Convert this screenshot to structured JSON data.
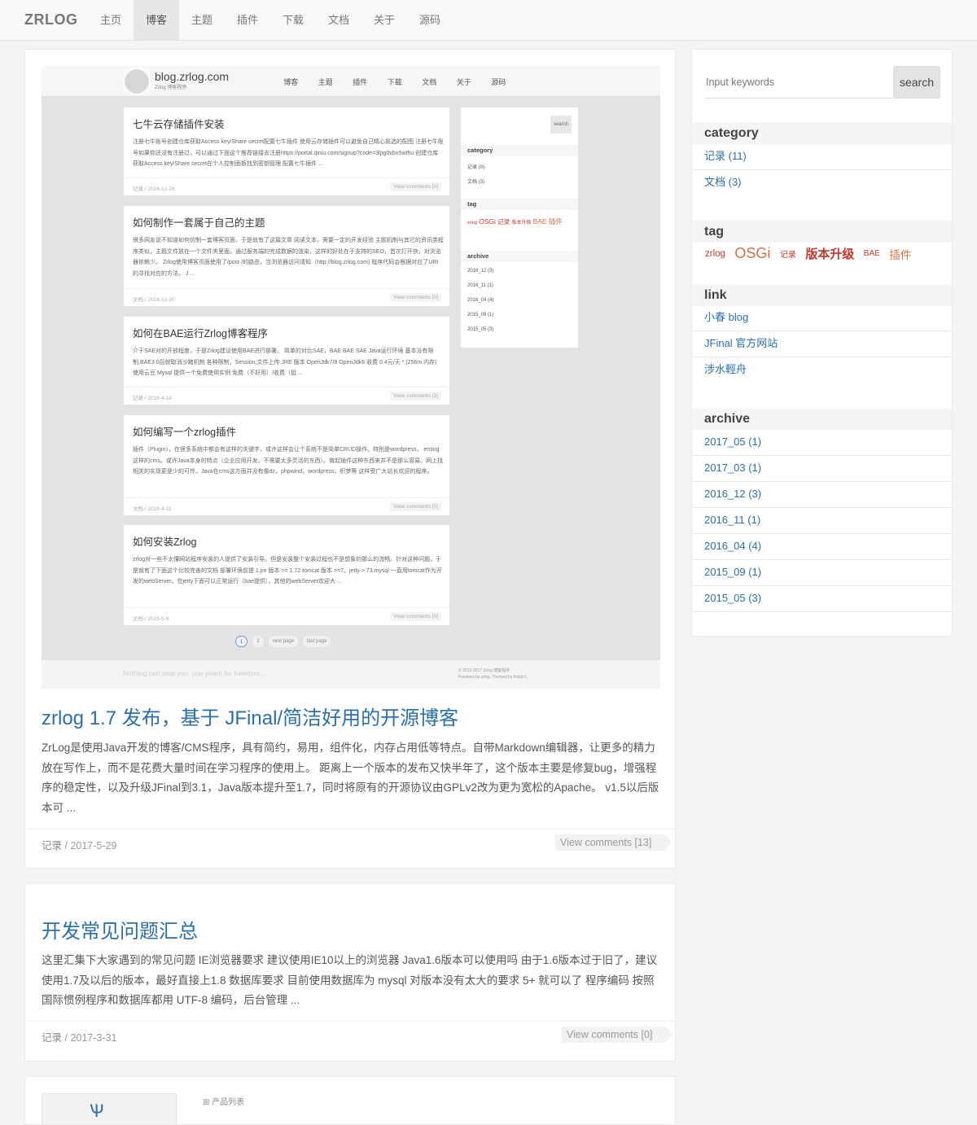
{
  "nav": {
    "brand": "ZRLOG",
    "items": [
      "主页",
      "博客",
      "主题",
      "插件",
      "下载",
      "文档",
      "关于",
      "源码"
    ],
    "active_index": 1
  },
  "posts": [
    {
      "title": "zrlog 1.7 发布，基于 JFinal/简洁好用的开源博客",
      "excerpt": "ZrLog是使用Java开发的博客/CMS程序，具有简约，易用，组件化，内存占用低等特点。自带Markdown编辑器，让更多的精力放在写作上，而不是花费大量时间在学习程序的使用上。 距离上一个版本的发布又快半年了，这个版本主要是修复bug，增强程序的稳定性，以及升级JFinal到3.1，Java版本提升至1.7，同时将原有的开源协议由GPLv2改为更为宽松的Apache。 v1.5以后版本可 ...",
      "category": "记录",
      "date": "2017-5-29",
      "comments": "View comments [13]"
    },
    {
      "title": "开发常见问题汇总",
      "excerpt": "这里汇集下大家遇到的常见问题 IE浏览器要求 建议使用IE10以上的浏览器 Java1.6版本可以使用吗 由于1.6版本过于旧了，建议使用1.7及以后的版本，最好直接上1.8 数据库要求 目前使用数据库为 mysql 对版本没有太大的要求 5+ 就可以了 程序编码 按照国际惯例程序和数据库都用 UTF-8 编码，后台管理 ...",
      "category": "记录",
      "date": "2017-3-31",
      "comments": "View comments [0]"
    }
  ],
  "post3": {
    "product_label": "产品列表",
    "logo_glyph": "Ѱ"
  },
  "screenshot": {
    "domain": "blog.zrlog.com",
    "subtitle": "Zrlog 博客程序",
    "nav": [
      "博客",
      "主题",
      "插件",
      "下载",
      "文档",
      "关于",
      "源码"
    ],
    "cards": [
      {
        "title": "七牛云存储插件安装",
        "excerpt": "注册七牛账号创建仓库获取Access key/Share secret配置七牛插件 使用云存储插件可以避免自己精心挑选的配图 注册七牛账号如果你还没有注册过，可以通过下面这个推荐链接去注册https://portal.qiniu.com/signup?code=3lpg0vbo5wthu 创建仓库 获取Access key/Share secret在个人控制面板找到密钥管理 配置七牛插件 ...",
        "meta": "记录 / 2016-12-26",
        "comments": "View comments [0]"
      },
      {
        "title": "如何制作一套属于自己的主题",
        "excerpt": "很多网友说不知道如何仿制一套博客页面，于是就有了这篇文章 阅读文本，需要一定的开发经验 主题机制与其它的资讯类程序类似，主题文件放在一个文件夹里面，通过服务端的完成数据的渲染，这样的好处在于支持的SEO，首次打开快，对浏览器依赖少。 Zrlog使用博客页面使用了/post /的路由，当浏览器访问请知（http://blog.zrlog.com) 程序代码会根据对应了URI的寻找对应的方法。 J ...",
        "meta": "文档 / 2016-12-20",
        "comments": "View comments [0]"
      },
      {
        "title": "如何在BAE运行Zrlog博客程序",
        "excerpt": "介于SAE对的开放程度，于是Zrlog建议使用BAE进行部署。 简单的对比SAE，BAE BAE SAE Java运行环境 基本没有限制,BAE3.0后就取消沙箱机制 各种限制，Session,文件上传 JRE 版本 OpenJdk7/8 OpenJdk6 收费 0.4元/天 * (256m 内存) 使用云豆 Mysql 提供一个免费使用实例 免费（不好用）/收费（挺 ...",
        "meta": "记录 / 2016-4-14",
        "comments": "View comments [3]"
      },
      {
        "title": "如何编写一个zrlog插件",
        "excerpt": "插件（Plugin），在很多系统中都会有这样的关键字，或许这样会让个系统不是简单CRUD操作。特别是wordpress， emlog 这样的cms。或许Java本身的特点（企业应用开发，不需要太多灵活的东西）。做起插件这种东西来并不是那么容易。网上找相关的实现更是少的可怜。Java在cms这方面并没有像dz，phpwind，wordpress，织梦等 这样受广大站长欢迎的程序。",
        "meta": "文档 / 2016-4-11",
        "comments": "View comments [0]"
      },
      {
        "title": "如何安装Zrlog",
        "excerpt": "zrlog对一些不太懂网站程序安装的人提供了安装引导。但是安装整个安装过程也不是想象的那么的流畅。针对这种问题，于是就有了下面这个比较完善的文档 部署环境前提 1.jre 版本 >= 1.72.tomcat 版本 >=7。jetty > 73.mysql 一直用tomcat作为开发的webServer。在jetty下面可以正常运行（bae提供），其他的webServer欢迎大 ...",
        "meta": "文档 / 2015-5-9",
        "comments": "View comments [0]"
      }
    ],
    "sidebar": {
      "search": "search",
      "category_title": "category",
      "categories": [
        "记录 (9)",
        "文档 (3)"
      ],
      "tag_title": "tag",
      "tags": [
        "zrlog",
        "OSGi",
        "记录",
        "版本升级",
        "BAE",
        "插件"
      ],
      "archive_title": "archive",
      "archives": [
        "2016_12 (3)",
        "2016_11 (1)",
        "2016_04 (4)",
        "2015_09 (1)",
        "2015_05 (3)"
      ]
    },
    "pager": [
      "1",
      "2",
      "next page",
      "last page"
    ],
    "footer_left": "Nothing can stop you, you yearn for freedom...",
    "footer_right_1": "© 2013-2017 Zrlog 博客程序",
    "footer_right_2": "Powered by zrlog. Themed by Robin L."
  },
  "sidebar": {
    "search_placeholder": "Input keywords",
    "search_label": "search",
    "category_title": "category",
    "categories": [
      "记录 (11)",
      "文档 (3)"
    ],
    "tag_title": "tag",
    "tags": [
      "zrlog",
      "OSGi",
      "记录",
      "版本升级",
      "BAE",
      "插件"
    ],
    "link_title": "link",
    "links": [
      "小春 blog",
      "JFinal 官方网站",
      "涉水輕舟"
    ],
    "archive_title": "archive",
    "archives": [
      "2017_05 (1)",
      "2017_03 (1)",
      "2016_12 (3)",
      "2016_11 (1)",
      "2016_04 (4)",
      "2015_09 (1)",
      "2015_05 (3)"
    ]
  },
  "colors": {
    "link": "#2a6fa8",
    "tag": "#c0392b",
    "tag_light": "#d2704a"
  }
}
